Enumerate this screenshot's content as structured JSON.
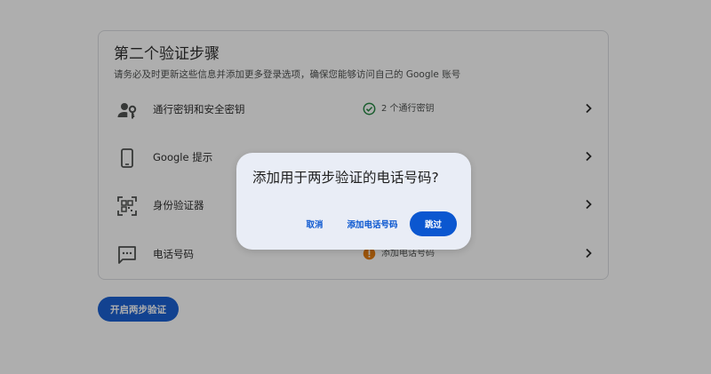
{
  "card": {
    "title": "第二个验证步骤",
    "subtitle": "请务必及时更新这些信息并添加更多登录选项，确保您能够访问自己的 Google 账号"
  },
  "methods": [
    {
      "label": "通行密钥和安全密钥",
      "icon": "person-key-icon",
      "status": "2 个通行密钥",
      "status_icon": "check-circle-icon",
      "status_color": "#188038"
    },
    {
      "label": "Google 提示",
      "icon": "phone-icon",
      "status": "",
      "status_icon": "",
      "status_color": ""
    },
    {
      "label": "身份验证器",
      "icon": "qr-scan-icon",
      "status": "",
      "status_icon": "",
      "status_color": ""
    },
    {
      "label": "电话号码",
      "icon": "message-icon",
      "status": "添加电话号码",
      "status_icon": "warning-icon",
      "status_color": "#e37400"
    }
  ],
  "primary_button": {
    "label": "开启两步验证"
  },
  "dialog": {
    "title": "添加用于两步验证的电话号码?",
    "cancel_label": "取消",
    "add_label": "添加电话号码",
    "skip_label": "跳过"
  },
  "colors": {
    "accent": "#0b57d0",
    "scrim": "rgba(31,31,31,0.36)",
    "dialog_bg": "#e9edf6",
    "success": "#188038",
    "warning": "#e37400"
  }
}
